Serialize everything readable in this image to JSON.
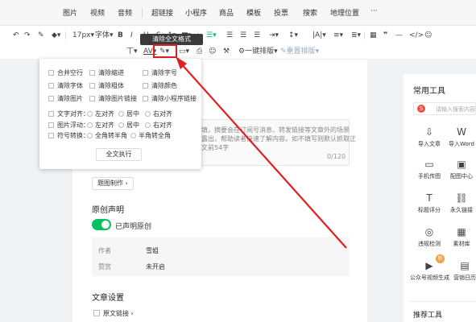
{
  "insert_bar": {
    "items": [
      "图片",
      "视频",
      "音频",
      "超链接",
      "小程序",
      "商品",
      "模板",
      "投票",
      "搜索",
      "地理位置",
      "···"
    ]
  },
  "toolbar": {
    "font_size": "17px",
    "font_label": "字体",
    "bold": "B",
    "italic": "I",
    "underline": "U",
    "letter_a": "A",
    "one_click": "一键排版",
    "format_brush": "重置排版",
    "tooltip": "清除全文格式"
  },
  "popup": {
    "row1": [
      "合并空行",
      "清除缩进",
      "清除字号"
    ],
    "row2": [
      "清除字体",
      "清除粗体",
      "清除颜色"
    ],
    "row3": [
      "清除图片",
      "清除图片链接",
      "清除小程序链接"
    ],
    "text_align_label": "文字对齐：",
    "text_align_opts": [
      "左对齐",
      "居中",
      "右对齐"
    ],
    "img_float_label": "图片浮动：",
    "img_float_opts": [
      "左对齐",
      "居中",
      "右对齐"
    ],
    "symbol_label": "符号转换：",
    "symbol_opts": [
      "全角转半角",
      "半角转全角"
    ],
    "exec_label": "全文执行"
  },
  "editor": {
    "desc_line1": "填，摘要会在订阅号消息、转发链接等文章外的场景",
    "desc_line2": "露出，帮助读者快速了解内容。如不填写则默认抓取正",
    "desc_line3": "文前54字",
    "counter": "0/120",
    "chip_label": "题图制作 ›",
    "original_title": "原创声明",
    "toggle_label": "已声明原创",
    "author_key": "作者",
    "author_val": "雪姐",
    "reward_key": "赞赏",
    "reward_val": "未开启",
    "settings_title": "文章设置",
    "orig_link": "原文链接 ›"
  },
  "right_panel": {
    "title": "常用工具",
    "search_logo": "S",
    "search_placeholder": "请输入搜索内容",
    "tools": [
      {
        "label": "导入文章",
        "icon": "⇩"
      },
      {
        "label": "导入Word",
        "icon": "W"
      },
      {
        "label": "手机传图",
        "icon": "▭"
      },
      {
        "label": "配图中心",
        "icon": "▣"
      },
      {
        "label": "标题评分",
        "icon": "T"
      },
      {
        "label": "永久链接",
        "icon": "⛓"
      },
      {
        "label": "违规检测",
        "icon": "◎"
      },
      {
        "label": "素材库",
        "icon": "▦"
      },
      {
        "label": "公众号视频生成",
        "icon": "▶"
      },
      {
        "label": "营销日历",
        "icon": "▤"
      }
    ],
    "badge": "新",
    "recommended_title": "推荐工具"
  },
  "colors": {
    "accent": "#07c160",
    "highlight": "#e02020"
  }
}
